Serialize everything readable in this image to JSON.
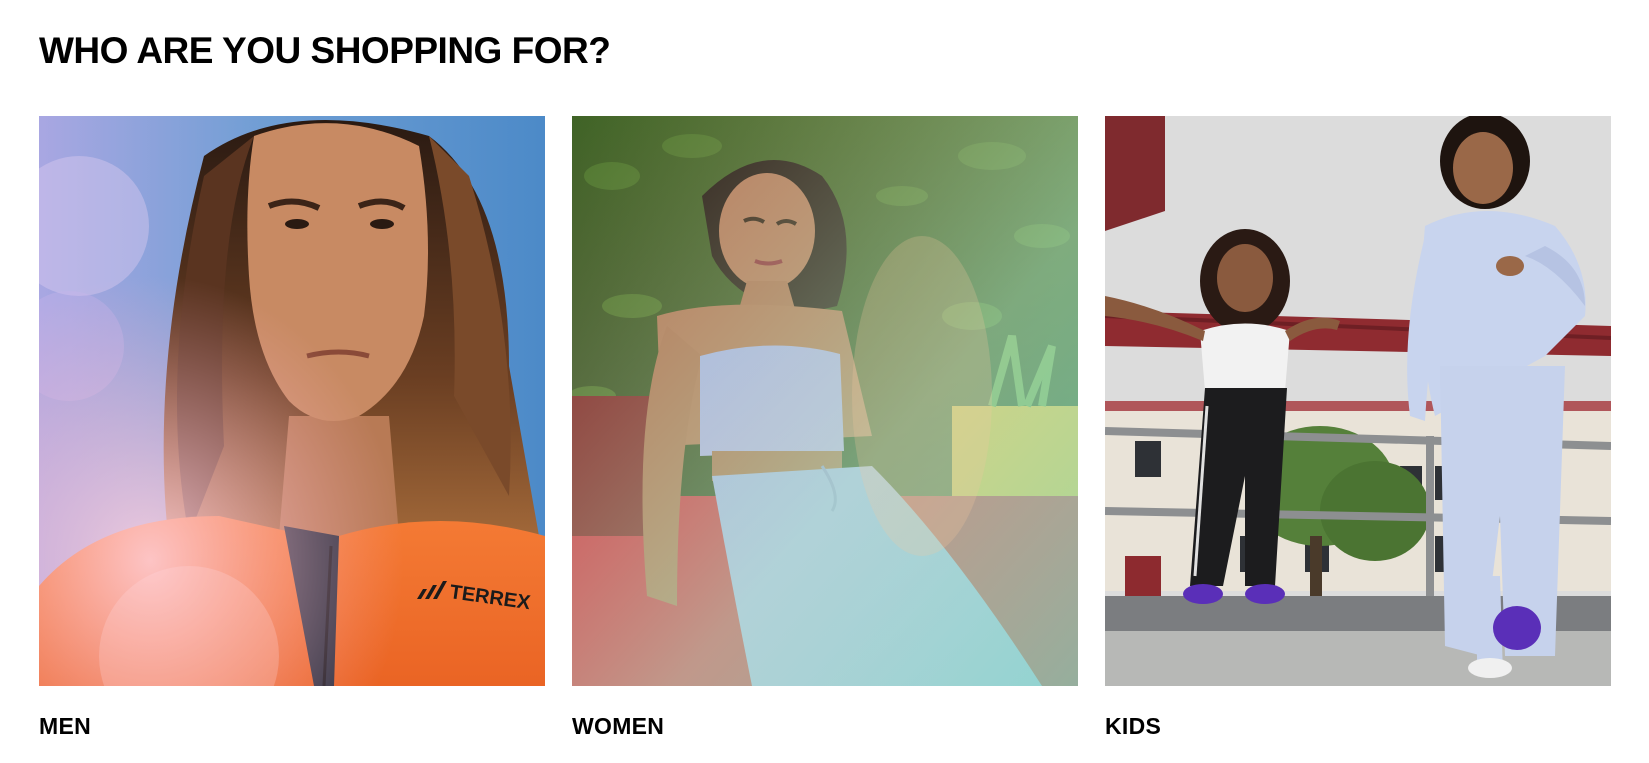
{
  "section": {
    "heading": "WHO ARE YOU SHOPPING FOR?"
  },
  "cards": [
    {
      "label": "MEN",
      "image_alt": "MEN",
      "jacket_brand": "TERREX"
    },
    {
      "label": "WOMEN",
      "image_alt": "WOMEN"
    },
    {
      "label": "KIDS",
      "image_alt": "KIDS"
    }
  ],
  "colors": {
    "text": "#000000",
    "background": "#ffffff",
    "men_sky": "#5b8fc9",
    "men_jacket": "#f0732e",
    "women_foliage": "#2f4a1f",
    "women_outfit": "#a9b3ea",
    "women_seat": "#d9324a",
    "kids_sky": "#dcdcdc",
    "kids_rail": "#8f2b30",
    "kids_hoodie": "#c8d4ee",
    "kids_sneakers": "#5a2fb8"
  }
}
